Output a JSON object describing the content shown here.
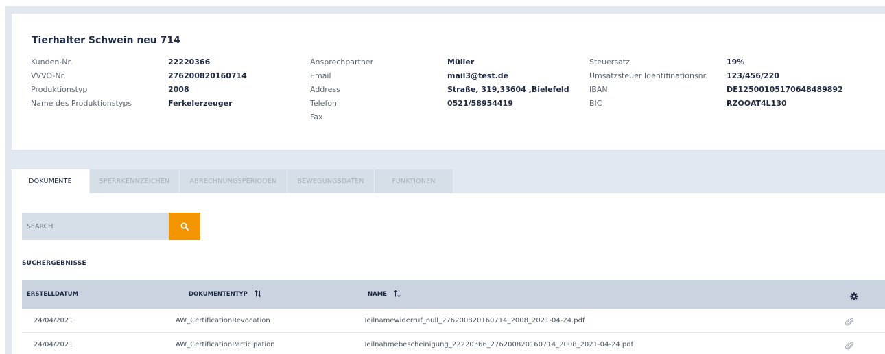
{
  "customer": {
    "title": "Tierhalter Schwein neu 714",
    "col1": [
      {
        "label": "Kunden-Nr.",
        "value": "22220366"
      },
      {
        "label": "VVVO-Nr.",
        "value": "276200820160714"
      },
      {
        "label": "Produktionstyp",
        "value": "2008"
      },
      {
        "label": "Name des Produktionstyps",
        "value": "Ferkelerzeuger"
      }
    ],
    "col2": [
      {
        "label": "Ansprechpartner",
        "value": "Müller"
      },
      {
        "label": "Email",
        "value": "mail3@test.de"
      },
      {
        "label": "Address",
        "value": "Straße, 319,33604 ,Bielefeld"
      },
      {
        "label": "Telefon",
        "value": "0521/58954419"
      },
      {
        "label": "Fax",
        "value": ""
      }
    ],
    "col3": [
      {
        "label": "Steuersatz",
        "value": "19%"
      },
      {
        "label": "Umsatzsteuer Identifinationsnr.",
        "value": "123/456/220"
      },
      {
        "label": "IBAN",
        "value": "DE12500105170648489892"
      },
      {
        "label": "BIC",
        "value": "RZOOAT4L130"
      }
    ]
  },
  "tabs": [
    {
      "label": "DOKUMENTE",
      "active": true
    },
    {
      "label": "SPERRKENNZEICHEN",
      "active": false
    },
    {
      "label": "ABRECHNUNGSPERIODEN",
      "active": false
    },
    {
      "label": "BEWEGUNGSDATEN",
      "active": false
    },
    {
      "label": "FUNKTIONEN",
      "active": false
    }
  ],
  "search": {
    "placeholder": "SEARCH",
    "value": ""
  },
  "results": {
    "title": "SUCHERGEBNISSE",
    "columns": [
      "ERSTELLDATUM",
      "DOKUMENTENTYP",
      "NAME"
    ],
    "rows": [
      {
        "date": "24/04/2021",
        "type": "AW_CertificationRevocation",
        "name": "Teilnamewiderruf_null_276200820160714_2008_2021-04-24.pdf"
      },
      {
        "date": "24/04/2021",
        "type": "AW_CertificationParticipation",
        "name": "Teilnahmebescheinigung_22220366_276200820160714_2008_2021-04-24.pdf"
      }
    ]
  },
  "colors": {
    "accent": "#f29500",
    "header": "#c9d4e0",
    "tab_bg": "#d6dfe8",
    "page_bg": "#e1e8f0",
    "text_dark": "#1f2a44"
  },
  "icons": {
    "search_button": "search-icon",
    "table_settings": "gear-icon",
    "row_action": "paperclip-icon",
    "sort": "sort-arrows-icon"
  }
}
